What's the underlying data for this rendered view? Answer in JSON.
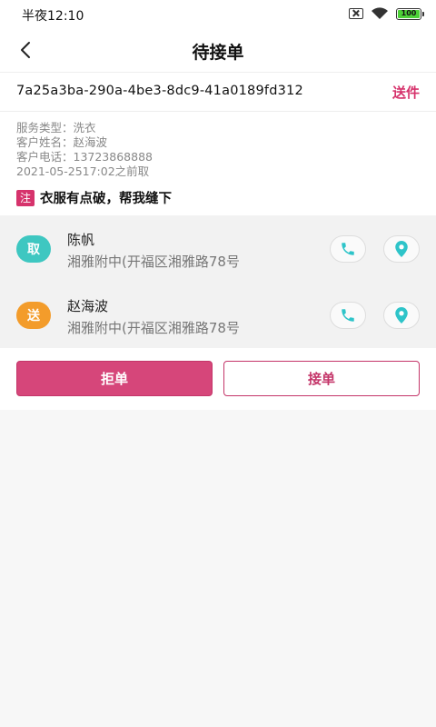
{
  "status_bar": {
    "time": "半夜12:10",
    "battery": "100"
  },
  "nav": {
    "title": "待接单"
  },
  "order": {
    "id": "7a25a3ba-290a-4be3-8dc9-41a0189fd312",
    "type_tag": "送件",
    "service_type": "服务类型：洗衣",
    "customer_name": "客户姓名：赵海波",
    "customer_phone": "客户电话：13723868888",
    "pickup_deadline": "2021-05-2517:02之前取",
    "note_badge": "注",
    "note": "衣服有点破，帮我缝下"
  },
  "contacts": [
    {
      "role": "取",
      "name": "陈帆",
      "address": "湘雅附中(开福区湘雅路78号",
      "role_color": "#3ec7c1"
    },
    {
      "role": "送",
      "name": "赵海波",
      "address": "湘雅附中(开福区湘雅路78号",
      "role_color": "#f39c2b"
    }
  ],
  "actions": {
    "reject_label": "拒单",
    "accept_label": "接单"
  },
  "colors": {
    "accent": "#d6336c",
    "icon_teal": "#2ec4c9"
  }
}
